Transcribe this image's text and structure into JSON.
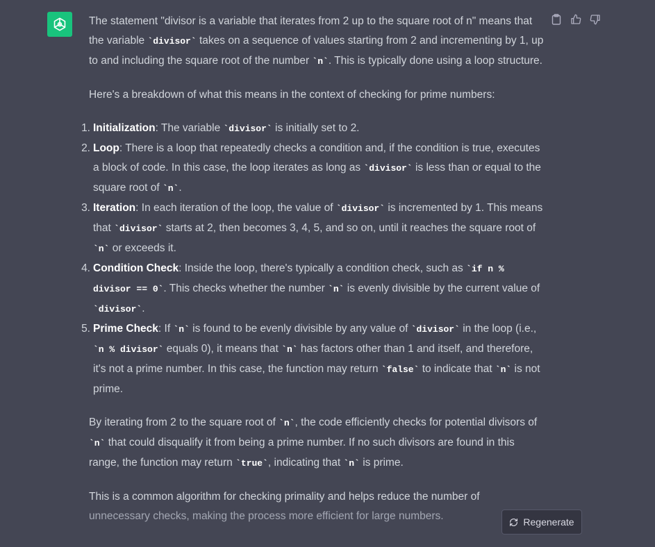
{
  "avatar": {
    "icon": "openai-logo-icon",
    "color": "#19c37d"
  },
  "actions": {
    "icons": [
      "clipboard-icon",
      "thumbs-up-icon",
      "thumbs-down-icon"
    ]
  },
  "message": {
    "intro": {
      "t1": "The statement \"divisor is a variable that iterates from 2 up to the square root of n\" means that the variable ",
      "c1": "`divisor`",
      "t2": " takes on a sequence of values starting from 2 and incrementing by 1, up to and including the square root of the number ",
      "c2": "`n`",
      "t3": ". This is typically done using a loop structure."
    },
    "breakdown": "Here's a breakdown of what this means in the context of checking for prime numbers:",
    "steps": [
      {
        "num": "1.",
        "term": "Initialization",
        "t1": ": The variable ",
        "c1": "`divisor`",
        "t2": " is initially set to 2."
      },
      {
        "num": "2.",
        "term": "Loop",
        "t1": ": There is a loop that repeatedly checks a condition and, if the condition is true, executes a block of code. In this case, the loop iterates as long as ",
        "c1": "`divisor`",
        "t2": " is less than or equal to the square root of ",
        "c2": "`n`",
        "t3": "."
      },
      {
        "num": "3.",
        "term": "Iteration",
        "t1": ": In each iteration of the loop, the value of ",
        "c1": "`divisor`",
        "t2": " is incremented by 1. This means that ",
        "c2": "`divisor`",
        "t3": " starts at 2, then becomes 3, 4, 5, and so on, until it reaches the square root of ",
        "c3": "`n`",
        "t4": " or exceeds it."
      },
      {
        "num": "4.",
        "term": "Condition Check",
        "t1": ": Inside the loop, there's typically a condition check, such as ",
        "c1": "`if n % divisor == 0`",
        "t2": ". This checks whether the number ",
        "c2": "`n`",
        "t3": " is evenly divisible by the current value of ",
        "c3": "`divisor`",
        "t4": "."
      },
      {
        "num": "5.",
        "term": "Prime Check",
        "t1": ": If ",
        "c1": "`n`",
        "t2": " is found to be evenly divisible by any value of ",
        "c2": "`divisor`",
        "t3": " in the loop (i.e., ",
        "c3": "`n % divisor`",
        "t4": " equals 0), it means that ",
        "c4": "`n`",
        "t5": " has factors other than 1 and itself, and therefore, it's not a prime number. In this case, the function may return ",
        "c5": "`false`",
        "t6": " to indicate that ",
        "c6": "`n`",
        "t7": " is not prime."
      }
    ],
    "summary": {
      "t1": "By iterating from 2 to the square root of ",
      "c1": "`n`",
      "t2": ", the code efficiently checks for potential divisors of ",
      "c2": "`n`",
      "t3": " that could disqualify it from being a prime number. If no such divisors are found in this range, the function may return ",
      "c3": "`true`",
      "t4": ", indicating that ",
      "c4": "`n`",
      "t5": " is prime."
    },
    "closing": {
      "t1": "This is a common algorithm for checking primality and helps reduce the number of ",
      "t2": "unnecessary checks, making the process more efficient for large numbers."
    }
  },
  "regenerate": {
    "label": "Regenerate",
    "icon": "refresh-icon"
  }
}
